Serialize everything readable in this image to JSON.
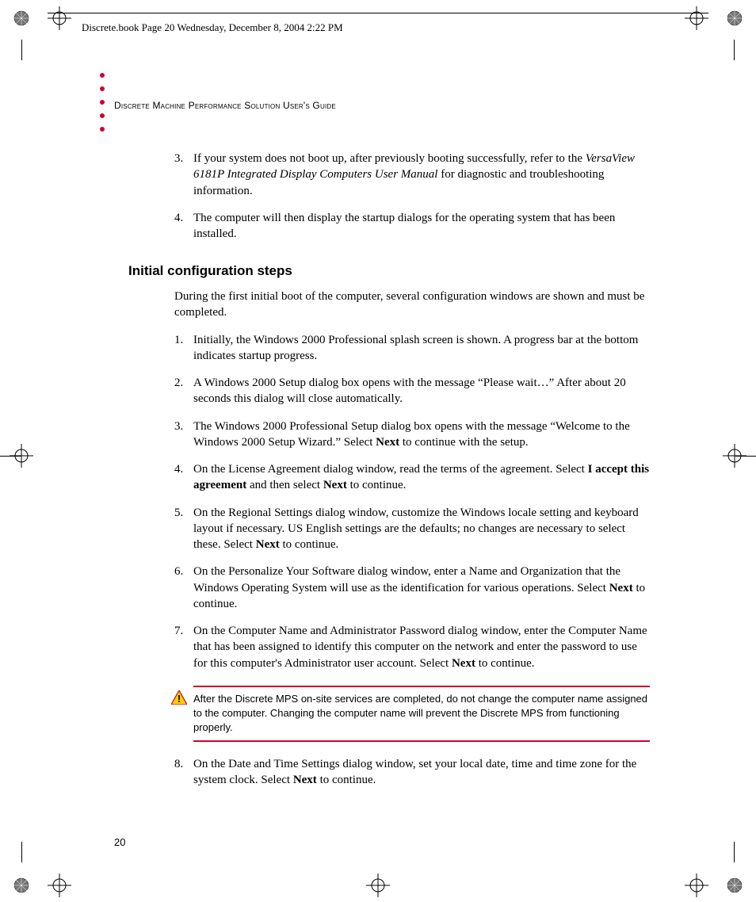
{
  "framemarker_text": "Discrete.book  Page 20  Wednesday, December 8, 2004  2:22 PM",
  "running_head": "Discrete Machine Performance Solution User's Guide",
  "page_number": "20",
  "top_list": [
    {
      "n": "3.",
      "html": "If your system does not boot up, after previously booting successfully, refer to the <em class='manual'>VersaView 6181P Integrated Display Computers User Manual</em> for diagnostic and troubleshooting information."
    },
    {
      "n": "4.",
      "html": "The computer will then display the startup dialogs for the operating system that has been installed."
    }
  ],
  "section_title": "Initial configuration steps",
  "section_intro": "During the first initial boot of the computer, several configuration windows are shown and must be completed.",
  "steps": [
    {
      "n": "1.",
      "html": "Initially, the Windows 2000 Professional splash screen is shown. A progress bar at the bottom indicates startup progress."
    },
    {
      "n": "2.",
      "html": "A Windows 2000 Setup dialog box opens with the message “Please wait…” After about 20 seconds this dialog will close automatically."
    },
    {
      "n": "3.",
      "html": "The Windows 2000 Professional Setup dialog box opens with the message “Welcome to the Windows 2000 Setup Wizard.” Select <b>Next</b> to continue with the setup."
    },
    {
      "n": "4.",
      "html": "On the License Agreement dialog window, read the terms of the agreement. Select <b>I accept this agreement</b> and then select <b>Next</b> to continue."
    },
    {
      "n": "5.",
      "html": "On the Regional Settings dialog window, customize the Windows locale setting and keyboard layout if necessary. US English settings are the defaults; no changes are necessary to select these. Select <b>Next</b> to continue."
    },
    {
      "n": "6.",
      "html": "On the Personalize Your Software dialog window, enter a Name and Organization that the Windows Operating System will use as the identification for various operations. Select <b>Next</b> to continue."
    },
    {
      "n": "7.",
      "html": "On the Computer Name and Administrator Password dialog window, enter the Computer Name that has been assigned to identify this computer on the network and enter the password to use for this computer's Administrator user account. Select <b>Next</b> to continue."
    }
  ],
  "warning_text": "After the Discrete MPS on-site services are completed, do not change the computer name assigned to the computer. Changing the computer name will prevent the Discrete MPS from functioning properly.",
  "steps_after_warning": [
    {
      "n": "8.",
      "html": "On the Date and Time Settings dialog window, set your local date, time and time zone for the system clock. Select <b>Next</b> to continue."
    }
  ]
}
